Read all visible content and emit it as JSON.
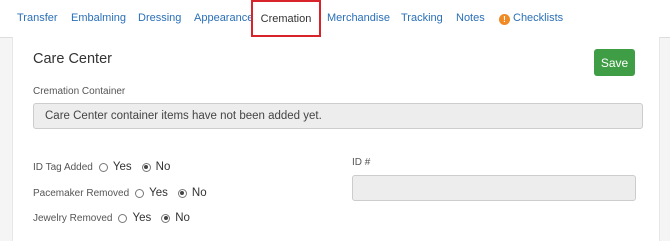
{
  "tabs": [
    {
      "label": "Transfer",
      "active": false
    },
    {
      "label": "Embalming",
      "active": false
    },
    {
      "label": "Dressing",
      "active": false
    },
    {
      "label": "Appearance",
      "active": false
    },
    {
      "label": "Cremation",
      "active": true
    },
    {
      "label": "Merchandise",
      "active": false
    },
    {
      "label": "Tracking",
      "active": false
    },
    {
      "label": "Notes",
      "active": false
    },
    {
      "label": "Checklists",
      "active": false,
      "icon": "warning-icon"
    }
  ],
  "panel": {
    "title": "Care Center",
    "save_label": "Save",
    "save_color": "#3f9e45",
    "container_label": "Cremation Container",
    "container_message": "Care Center container items have not been added yet.",
    "id_label": "ID #",
    "id_value": "",
    "questions": [
      {
        "label": "ID Tag Added",
        "options": [
          "Yes",
          "No"
        ],
        "selected": "No"
      },
      {
        "label": "Pacemaker Removed",
        "options": [
          "Yes",
          "No"
        ],
        "selected": "No"
      },
      {
        "label": "Jewelry Removed",
        "options": [
          "Yes",
          "No"
        ],
        "selected": "No"
      }
    ]
  },
  "colors": {
    "link": "#2a6fb8",
    "active_tab_border": "#d9232a",
    "warning": "#f08a24"
  }
}
